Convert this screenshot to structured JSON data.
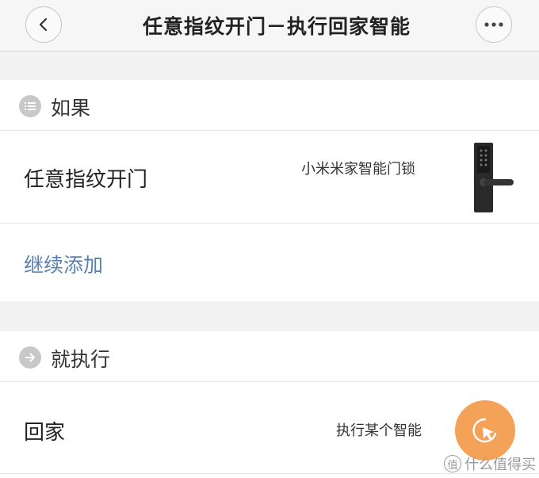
{
  "header": {
    "title": "任意指纹开门－执行回家智能",
    "back_icon": "chevron-left-icon",
    "more_icon": "more-dots-icon"
  },
  "if_section": {
    "label": "如果",
    "icon": "list-icon",
    "trigger": {
      "title": "任意指纹开门",
      "device": "小米米家智能门锁",
      "device_image": "door-lock-icon"
    },
    "add_link": "继续添加"
  },
  "then_section": {
    "label": "就执行",
    "icon": "arrow-right-icon",
    "action": {
      "title": "回家",
      "type": "执行某个智能",
      "button_icon": "cursor-click-icon"
    }
  },
  "watermark": {
    "badge": "值",
    "text": "什么值得买"
  },
  "colors": {
    "link": "#5a7fb1",
    "accent_orange": "#f4a257",
    "section_icon": "#c8c8c8"
  }
}
